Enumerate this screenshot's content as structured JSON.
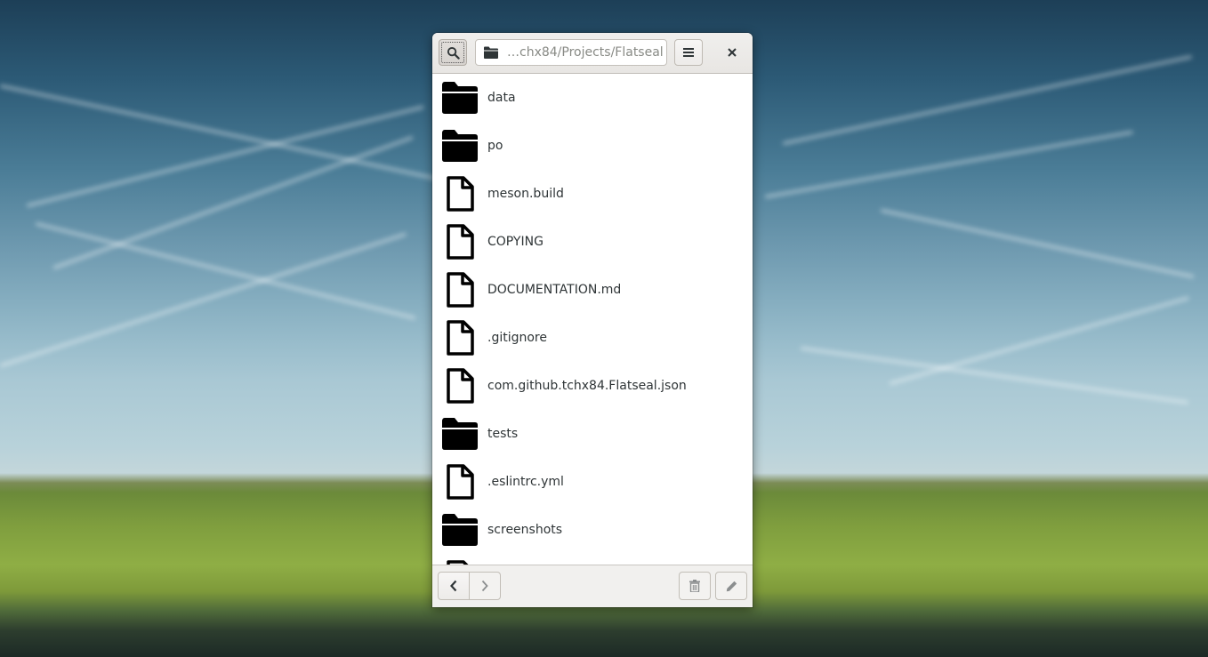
{
  "window": {
    "path_entry": "…chx84/Projects/Flatseal",
    "icons": {
      "search": "search-icon",
      "path_folder": "folder-icon",
      "menu": "hamburger-menu-icon",
      "close": "close-icon"
    }
  },
  "files": [
    {
      "name": "data",
      "type": "folder"
    },
    {
      "name": "po",
      "type": "folder"
    },
    {
      "name": "meson.build",
      "type": "file"
    },
    {
      "name": "COPYING",
      "type": "file"
    },
    {
      "name": "DOCUMENTATION.md",
      "type": "file"
    },
    {
      "name": ".gitignore",
      "type": "file"
    },
    {
      "name": "com.github.tchx84.Flatseal.json",
      "type": "file"
    },
    {
      "name": "tests",
      "type": "folder"
    },
    {
      "name": ".eslintrc.yml",
      "type": "file"
    },
    {
      "name": "screenshots",
      "type": "folder"
    }
  ],
  "footer": {
    "icons": {
      "back": "chevron-left-icon",
      "forward": "chevron-right-icon",
      "delete": "trash-icon",
      "rename": "pencil-icon"
    }
  },
  "colors": {
    "text": "#2e3436",
    "placeholder": "#888a85",
    "headerbar": "#e8e6e3"
  }
}
